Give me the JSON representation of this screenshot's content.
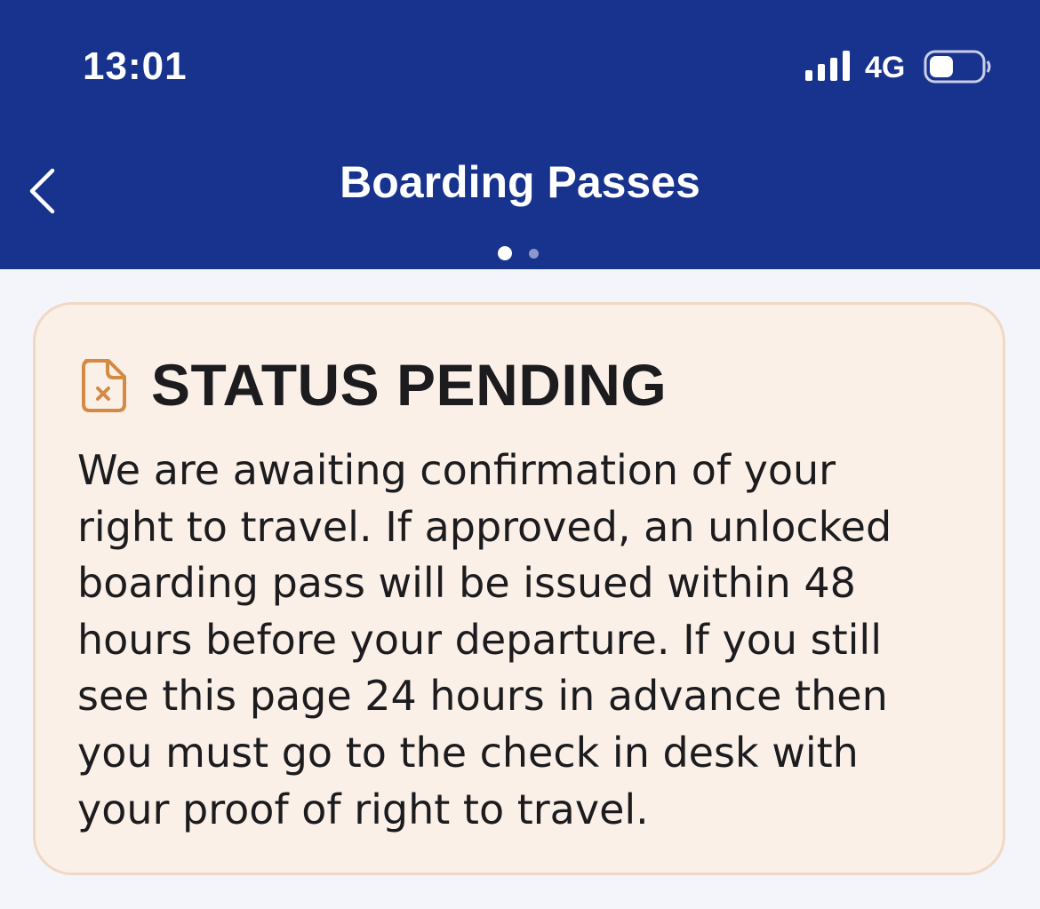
{
  "status_bar": {
    "time": "13:01",
    "network": "4G",
    "signal_icon": "cellular-signal-icon",
    "battery_icon": "battery-icon"
  },
  "nav": {
    "title": "Boarding Passes",
    "back_icon": "chevron-left-icon",
    "page_count": 2,
    "current_page": 1
  },
  "status_card": {
    "icon": "document-cross-icon",
    "heading": "STATUS PENDING",
    "message_lines": [
      "We are awaiting confirmation of your",
      "right to travel. If approved, an unlocked",
      "boarding pass will be issued within 48",
      "hours before your departure. If you still",
      "see this page 24 hours in advance then",
      "you must go to the check in desk with",
      "your proof of right to travel."
    ]
  },
  "colors": {
    "header_bg": "#18338e",
    "page_bg": "#f4f5fa",
    "card_bg": "#faf0e8",
    "card_border": "#f0d8c5",
    "icon_accent": "#d38a45",
    "text": "#1c1c1e"
  }
}
